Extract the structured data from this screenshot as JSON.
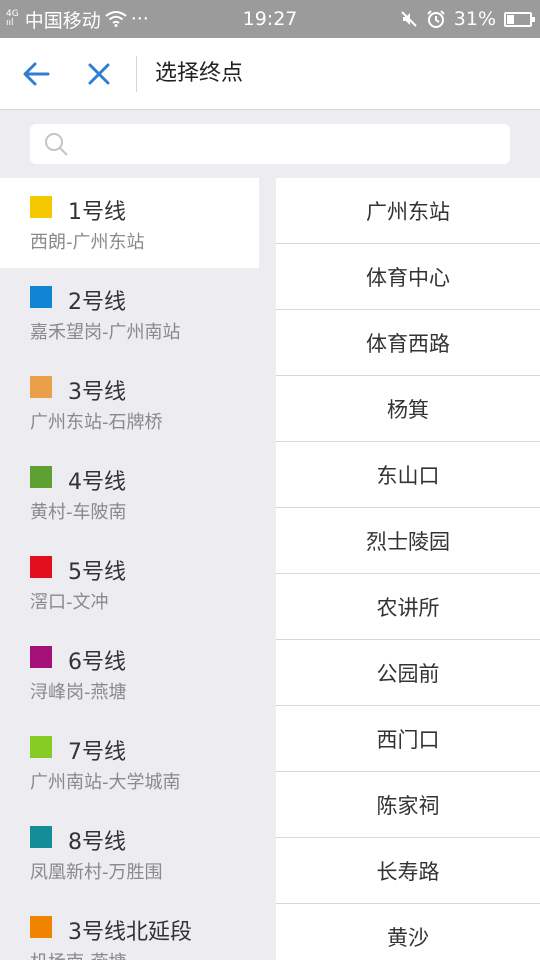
{
  "status_bar": {
    "network": "4G",
    "network_sub": "ııl",
    "carrier": "中国移动",
    "dots": "···",
    "time": "19:27",
    "battery": "31%",
    "battery_level": 0.31,
    "icons": [
      "wifi-icon",
      "mute-icon",
      "alarm-icon",
      "battery-icon"
    ]
  },
  "header": {
    "title": "选择终点",
    "back_icon": "back-arrow-icon",
    "close_icon": "close-icon",
    "accent": "#2f7fd0"
  },
  "search": {
    "placeholder": "",
    "value": "",
    "icon": "search-icon"
  },
  "lines": [
    {
      "name": "1号线",
      "route": "西朗-广州东站",
      "color": "#f5c800",
      "active": true
    },
    {
      "name": "2号线",
      "route": "嘉禾望岗-广州南站",
      "color": "#1284d6"
    },
    {
      "name": "3号线",
      "route": "广州东站-石牌桥",
      "color": "#e9a048"
    },
    {
      "name": "4号线",
      "route": "黄村-车陂南",
      "color": "#5fa033"
    },
    {
      "name": "5号线",
      "route": "滘口-文冲",
      "color": "#e40f1c"
    },
    {
      "name": "6号线",
      "route": "浔峰岗-燕塘",
      "color": "#a50f78"
    },
    {
      "name": "7号线",
      "route": "广州南站-大学城南",
      "color": "#86cc24"
    },
    {
      "name": "8号线",
      "route": "凤凰新村-万胜围",
      "color": "#138e96"
    },
    {
      "name": "3号线北延段",
      "route": "机场南-燕塘",
      "color": "#f08300"
    }
  ],
  "stations": [
    "广州东站",
    "体育中心",
    "体育西路",
    "杨箕",
    "东山口",
    "烈士陵园",
    "农讲所",
    "公园前",
    "西门口",
    "陈家祠",
    "长寿路",
    "黄沙"
  ]
}
